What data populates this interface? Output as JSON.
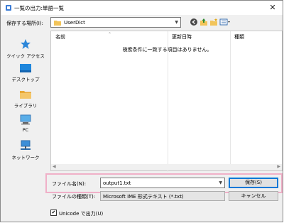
{
  "window": {
    "title": "一覧の出力:単語一覧",
    "close_label": "✕"
  },
  "location": {
    "label": "保存する場所(I):",
    "path": "UserDict"
  },
  "toolbar": {
    "icons": [
      "back-icon",
      "up-folder-icon",
      "new-folder-icon",
      "view-menu-icon"
    ]
  },
  "sidebar": {
    "items": [
      {
        "label": "クイック アクセス",
        "icon": "star-icon"
      },
      {
        "label": "デスクトップ",
        "icon": "desktop-icon"
      },
      {
        "label": "ライブラリ",
        "icon": "library-icon"
      },
      {
        "label": "PC",
        "icon": "computer-icon"
      },
      {
        "label": "ネットワーク",
        "icon": "network-icon"
      }
    ]
  },
  "filelist": {
    "columns": [
      "名前",
      "更新日時",
      "種類"
    ],
    "empty_message": "検索条件に一致する項目はありません。"
  },
  "filename": {
    "label": "ファイル名(N):",
    "value": "output1.txt"
  },
  "filetype": {
    "label": "ファイルの種類(T):",
    "value": "Microsoft IME 形式テキスト (*.txt)"
  },
  "buttons": {
    "save": "保存(S)",
    "cancel": "キャンセル"
  },
  "unicode": {
    "label": "Unicode で出力(U)",
    "checked": true
  },
  "colors": {
    "highlight": "#f0b0c8",
    "accent": "#0078d7"
  }
}
